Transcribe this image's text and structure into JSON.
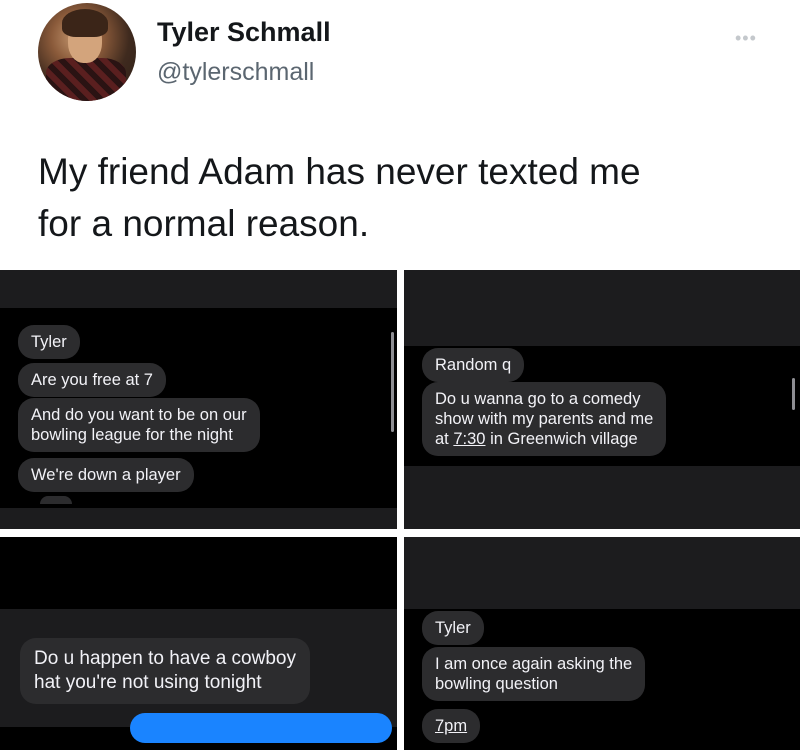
{
  "tweet": {
    "author_name": "Tyler Schmall",
    "author_handle": "@tylerschmall",
    "more_icon": "more-horizontal-icon",
    "text_line1": "My friend Adam has never texted me",
    "text_line2": "for a normal reason."
  },
  "screenshots": [
    {
      "messages": [
        "Tyler",
        "Are you free at 7",
        "And do you want to be on our",
        "bowling league for the night",
        "We're down a player"
      ]
    },
    {
      "messages": [
        "Random q",
        "Do u wanna go to a comedy",
        "show with my parents and me",
        "at ",
        "7:30",
        " in Greenwich village"
      ]
    },
    {
      "messages": [
        "Do u happen to have a cowboy",
        "hat you're not using tonight"
      ]
    },
    {
      "messages": [
        "Tyler",
        "I am once again asking the",
        "bowling question",
        "7pm"
      ]
    }
  ],
  "colors": {
    "panel_bg": "#000000",
    "received_bubble": "#2c2c2e",
    "sent_bubble": "#1a84ff",
    "text_light": "#f2f2f7"
  }
}
